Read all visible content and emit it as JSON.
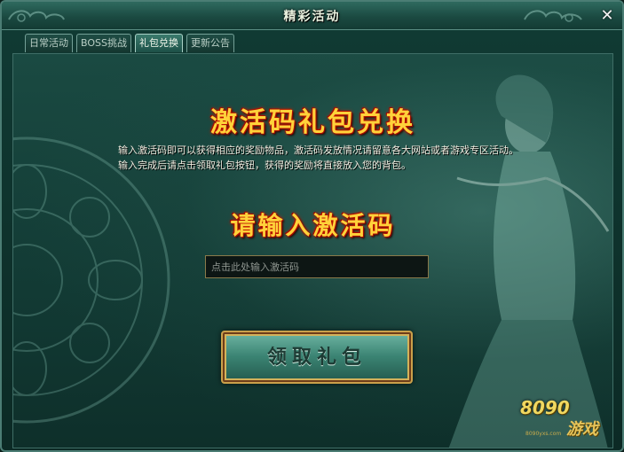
{
  "window": {
    "title": "精彩活动",
    "close_label": "✕"
  },
  "tabs": [
    {
      "label": "日常活动",
      "active": false
    },
    {
      "label": "BOSS挑战",
      "active": false
    },
    {
      "label": "礼包兑换",
      "active": true
    },
    {
      "label": "更新公告",
      "active": false
    }
  ],
  "main": {
    "exchange_heading": "激活码礼包兑换",
    "description_line1": "输入激活码即可以获得相应的奖励物品，激活码发放情况请留意各大网站或者游戏专区活动。",
    "description_line2": "输入完成后请点击领取礼包按钮，获得的奖励将直接放入您的背包。",
    "input_heading": "请输入激活码",
    "code_input_placeholder": "点击此处输入激活码",
    "code_input_value": "",
    "claim_button_label": "领取礼包"
  },
  "logo": {
    "number": "8090",
    "text": "游戏",
    "sub": "8090yxs.com"
  },
  "colors": {
    "heading_gold": "#ffd23a",
    "heading_glow": "#c01000",
    "panel_teal": "#1a4a42",
    "button_border": "#caa04a"
  }
}
